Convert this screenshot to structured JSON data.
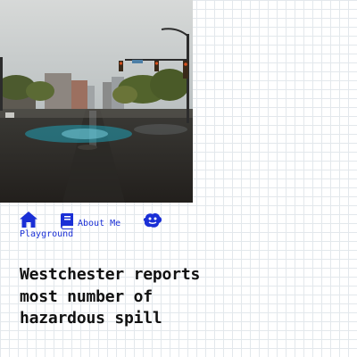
{
  "hero": {
    "subject": "rainy-city-street-photo"
  },
  "nav": {
    "home_icon": "house-icon",
    "about_icon": "book-icon",
    "about_label": "About Me",
    "playground_icon": "otter-icon",
    "playground_label": "Playground"
  },
  "article": {
    "title": "Westchester reports most number of hazardous spill"
  },
  "colors": {
    "link": "#1a2fd6",
    "text": "#111111",
    "grid": "#e3e8ec"
  }
}
